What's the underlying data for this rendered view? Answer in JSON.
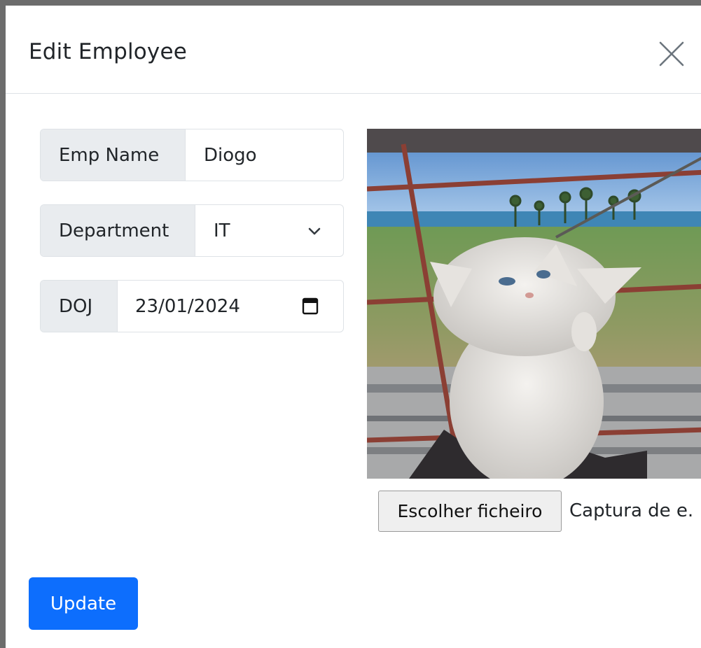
{
  "modal": {
    "title": "Edit Employee",
    "close_icon": "close-icon"
  },
  "form": {
    "emp_name": {
      "label": "Emp Name",
      "value": "Diogo"
    },
    "department": {
      "label": "Department",
      "selected": "IT",
      "icon": "chevron-down-icon"
    },
    "doj": {
      "label": "DOJ",
      "value": "23/01/2024",
      "icon": "calendar-icon"
    }
  },
  "photo": {
    "description_hidden": true
  },
  "file_input": {
    "button_label": "Escolher ficheiro",
    "file_name": "Captura de e."
  },
  "actions": {
    "update_label": "Update"
  },
  "colors": {
    "primary": "#0d6efd",
    "addon_bg": "#e9ecef",
    "border": "#dee2e6"
  }
}
